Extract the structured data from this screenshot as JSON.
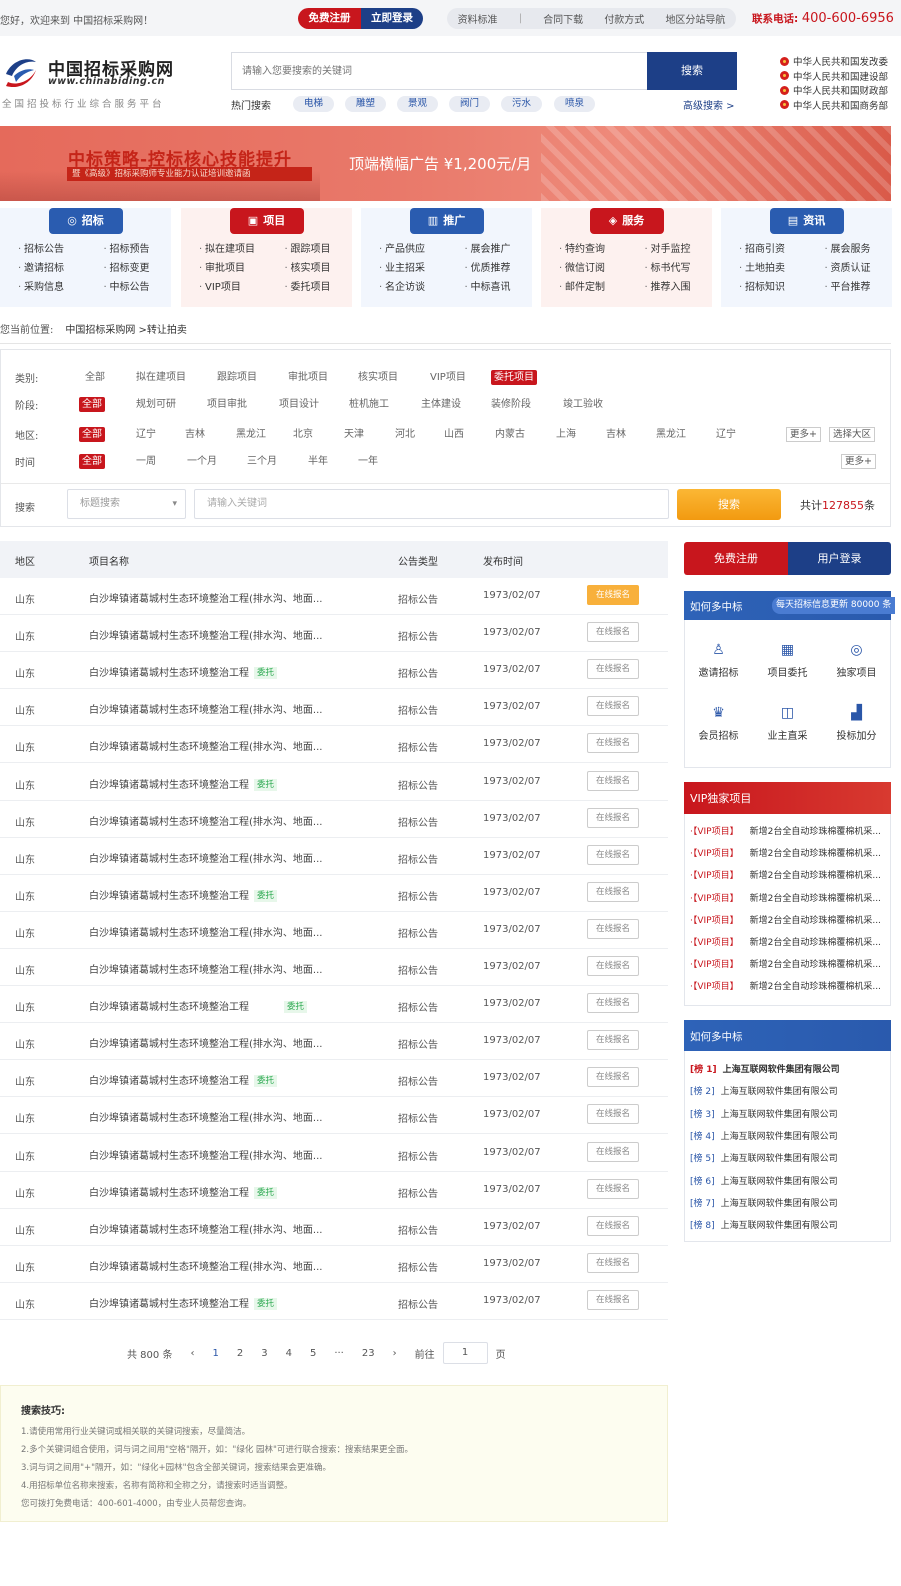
{
  "topbar": {
    "welcome": "您好，欢迎来到 中国招标采购网！",
    "free_register": "免费注册",
    "login": "立即登录",
    "links": [
      "资料标准",
      "合同下载",
      "付款方式",
      "地区分站导航"
    ],
    "hotline_label": "联系电话:",
    "hotline": "400-600-6956"
  },
  "header": {
    "logo_cn": "中国招标采购网",
    "logo_en": "www.chinabiding.cn",
    "slogan": "全国招投标行业综合服务平台",
    "search_placeholder": "请输入您要搜索的关键词",
    "search_button": "搜索",
    "hot_label": "热门搜索",
    "hot_tags": [
      "电梯",
      "雕塑",
      "景观",
      "阀门",
      "污水",
      "喷泉"
    ],
    "advanced_search": "高级搜索 >",
    "gov_links": [
      "中华人民共和国发改委",
      "中华人民共和国建设部",
      "中华人民共和国财政部",
      "中华人民共和国商务部"
    ]
  },
  "banner": {
    "title": "中标策略-控标核心技能提升",
    "subtitle": "暨《高级》招标采购师专业能力认证培训邀请函",
    "ad": "顶端横幅广告  ¥1,200元/月"
  },
  "nav_cards": [
    {
      "label": "招标",
      "color": "#2a5cb0",
      "icon": "gavel-icon",
      "glyph": "◎",
      "items": [
        "招标公告",
        "招标预告",
        "邀请招标",
        "招标变更",
        "采购信息",
        "中标公告"
      ],
      "bg": "#f2f6fd"
    },
    {
      "label": "项目",
      "color": "#c8161d",
      "icon": "briefcase-icon",
      "glyph": "▣",
      "items": [
        "拟在建项目",
        "跟踪项目",
        "审批项目",
        "核实项目",
        "VIP项目",
        "委托项目"
      ],
      "bg": "#fdf1ef"
    },
    {
      "label": "推广",
      "color": "#2a5cb0",
      "icon": "chart-icon",
      "glyph": "▥",
      "items": [
        "产品供应",
        "展会推广",
        "业主招采",
        "优质推荐",
        "名企访谈",
        "中标喜讯"
      ],
      "bg": "#f2f6fd"
    },
    {
      "label": "服务",
      "color": "#c8161d",
      "icon": "service-icon",
      "glyph": "◈",
      "items": [
        "特约查询",
        "对手监控",
        "微信订阅",
        "标书代写",
        "邮件定制",
        "推荐入围"
      ],
      "bg": "#fdf1ef"
    },
    {
      "label": "资讯",
      "color": "#2a5cb0",
      "icon": "news-icon",
      "glyph": "▤",
      "items": [
        "招商引资",
        "展会服务",
        "土地拍卖",
        "资质认证",
        "招标知识",
        "平台推荐"
      ],
      "bg": "#f2f6fd"
    }
  ],
  "breadcrumb": {
    "label": "您当前位置:",
    "path": "中国招标采购网 >转让拍卖"
  },
  "filters": {
    "category": {
      "label": "类别:",
      "options": [
        "全部",
        "拟在建项目",
        "跟踪项目",
        "审批项目",
        "核实项目",
        "VIP项目",
        "委托项目"
      ],
      "selected": 6
    },
    "stage": {
      "label": "阶段:",
      "options": [
        "全部",
        "规划可研",
        "项目审批",
        "项目设计",
        "桩机施工",
        "主体建设",
        "装修阶段",
        "竣工验收"
      ],
      "selected": 0
    },
    "region": {
      "label": "地区:",
      "options": [
        "全部",
        "辽宁",
        "吉林",
        "黑龙江",
        "北京",
        "天津",
        "河北",
        "山西",
        "内蒙古",
        "上海",
        "吉林",
        "黑龙江",
        "辽宁"
      ],
      "selected": 0,
      "more": "更多+",
      "pick_area": "选择大区"
    },
    "time": {
      "label": "时间",
      "options": [
        "全部",
        "一周",
        "一个月",
        "三个月",
        "半年",
        "一年"
      ],
      "selected": 0,
      "more": "更多+"
    }
  },
  "search2": {
    "label": "搜索",
    "select_value": "标题搜索",
    "placeholder": "请输入关键词",
    "button": "搜索",
    "total_prefix": "共计",
    "total_count": "127855",
    "total_suffix": "条"
  },
  "table": {
    "headers": [
      "地区",
      "项目名称",
      "公告类型",
      "发布时间"
    ],
    "register_label": "在线报名",
    "rows": [
      {
        "region": "山东",
        "name": "白沙埠镇诸葛城村生态环境整治工程(排水沟、地面...",
        "tag": "",
        "type": "招标公告",
        "date": "1973/02/07",
        "hot": true
      },
      {
        "region": "山东",
        "name": "白沙埠镇诸葛城村生态环境整治工程(排水沟、地面...",
        "tag": "",
        "type": "招标公告",
        "date": "1973/02/07",
        "hot": false
      },
      {
        "region": "山东",
        "name": "白沙埠镇诸葛城村生态环境整治工程",
        "tag": "委托",
        "type": "招标公告",
        "date": "1973/02/07",
        "hot": false
      },
      {
        "region": "山东",
        "name": "白沙埠镇诸葛城村生态环境整治工程(排水沟、地面...",
        "tag": "",
        "type": "招标公告",
        "date": "1973/02/07",
        "hot": false
      },
      {
        "region": "山东",
        "name": "白沙埠镇诸葛城村生态环境整治工程(排水沟、地面...",
        "tag": "",
        "type": "招标公告",
        "date": "1973/02/07",
        "hot": false
      },
      {
        "region": "山东",
        "name": "白沙埠镇诸葛城村生态环境整治工程",
        "tag": "委托",
        "type": "招标公告",
        "date": "1973/02/07",
        "hot": false
      },
      {
        "region": "山东",
        "name": "白沙埠镇诸葛城村生态环境整治工程(排水沟、地面...",
        "tag": "",
        "type": "招标公告",
        "date": "1973/02/07",
        "hot": false
      },
      {
        "region": "山东",
        "name": "白沙埠镇诸葛城村生态环境整治工程(排水沟、地面...",
        "tag": "",
        "type": "招标公告",
        "date": "1973/02/07",
        "hot": false
      },
      {
        "region": "山东",
        "name": "白沙埠镇诸葛城村生态环境整治工程",
        "tag": "委托",
        "type": "招标公告",
        "date": "1973/02/07",
        "hot": false
      },
      {
        "region": "山东",
        "name": "白沙埠镇诸葛城村生态环境整治工程(排水沟、地面...",
        "tag": "",
        "type": "招标公告",
        "date": "1973/02/07",
        "hot": false
      },
      {
        "region": "山东",
        "name": "白沙埠镇诸葛城村生态环境整治工程(排水沟、地面...",
        "tag": "",
        "type": "招标公告",
        "date": "1973/02/07",
        "hot": false
      },
      {
        "region": "山东",
        "name": "白沙埠镇诸葛城村生态环境整治工程",
        "tag": "委托",
        "type": "招标公告",
        "date": "1973/02/07",
        "hot": false,
        "wide_tag": true
      },
      {
        "region": "山东",
        "name": "白沙埠镇诸葛城村生态环境整治工程(排水沟、地面...",
        "tag": "",
        "type": "招标公告",
        "date": "1973/02/07",
        "hot": false
      },
      {
        "region": "山东",
        "name": "白沙埠镇诸葛城村生态环境整治工程",
        "tag": "委托",
        "type": "招标公告",
        "date": "1973/02/07",
        "hot": false
      },
      {
        "region": "山东",
        "name": "白沙埠镇诸葛城村生态环境整治工程(排水沟、地面...",
        "tag": "",
        "type": "招标公告",
        "date": "1973/02/07",
        "hot": false
      },
      {
        "region": "山东",
        "name": "白沙埠镇诸葛城村生态环境整治工程(排水沟、地面...",
        "tag": "",
        "type": "招标公告",
        "date": "1973/02/07",
        "hot": false
      },
      {
        "region": "山东",
        "name": "白沙埠镇诸葛城村生态环境整治工程",
        "tag": "委托",
        "type": "招标公告",
        "date": "1973/02/07",
        "hot": false
      },
      {
        "region": "山东",
        "name": "白沙埠镇诸葛城村生态环境整治工程(排水沟、地面...",
        "tag": "",
        "type": "招标公告",
        "date": "1973/02/07",
        "hot": false
      },
      {
        "region": "山东",
        "name": "白沙埠镇诸葛城村生态环境整治工程(排水沟、地面...",
        "tag": "",
        "type": "招标公告",
        "date": "1973/02/07",
        "hot": false
      },
      {
        "region": "山东",
        "name": "白沙埠镇诸葛城村生态环境整治工程",
        "tag": "委托",
        "type": "招标公告",
        "date": "1973/02/07",
        "hot": false
      }
    ]
  },
  "pager": {
    "total": "共 800 条",
    "prev": "‹",
    "pages": [
      "1",
      "2",
      "3",
      "4",
      "5",
      "···",
      "23"
    ],
    "current": "1",
    "next": "›",
    "goto_label": "前往",
    "goto_value": "1",
    "goto_suffix": "页"
  },
  "tips": {
    "title": "搜索技巧:",
    "lines": [
      "1.请使用常用行业关键词或相关联的关键词搜索，尽量简洁。",
      "2.多个关键词组合使用，词与词之间用\"空格\"隔开，如：\"绿化 园林\"可进行联合搜索：搜索结果更全面。",
      "3.词与词之间用\"+\"隔开，如：\"绿化+园林\"包含全部关键词，搜索结果会更准确。",
      "4.用招标单位名称来搜索，名称有简称和全称之分，请搜索时适当调整。",
      "您可拨打免费电话：400-601-4000，由专业人员帮您查询。"
    ]
  },
  "sidebar": {
    "register": "免费注册",
    "login": "用户登录",
    "box1_title": "如何多中标",
    "box1_badge": "每天招标信息更新 80000 条",
    "quick": [
      {
        "label": "邀请招标",
        "icon": "invite-user-icon",
        "glyph": "♙"
      },
      {
        "label": "项目委托",
        "icon": "document-icon",
        "glyph": "▦"
      },
      {
        "label": "独家项目",
        "icon": "target-icon",
        "glyph": "◎"
      },
      {
        "label": "会员招标",
        "icon": "crown-icon",
        "glyph": "♛"
      },
      {
        "label": "业主直采",
        "icon": "basket-icon",
        "glyph": "◫"
      },
      {
        "label": "投标加分",
        "icon": "bar-chart-icon",
        "glyph": "▟"
      }
    ],
    "vip_title": "VIP独家项目",
    "vip_prefix": "·【VIP项目】",
    "vip_items": [
      "新增2台全自动珍珠棉覆棉机采...",
      "新增2台全自动珍珠棉覆棉机采...",
      "新增2台全自动珍珠棉覆棉机采...",
      "新增2台全自动珍珠棉覆棉机采...",
      "新增2台全自动珍珠棉覆棉机采...",
      "新增2台全自动珍珠棉覆棉机采...",
      "新增2台全自动珍珠棉覆棉机采...",
      "新增2台全自动珍珠棉覆棉机采..."
    ],
    "rank_title": "如何多中标",
    "rank_items": [
      {
        "rank": "[榜 1]",
        "name": "上海互联网软件集团有限公司"
      },
      {
        "rank": "[榜 2]",
        "name": "上海互联网软件集团有限公司"
      },
      {
        "rank": "[榜 3]",
        "name": "上海互联网软件集团有限公司"
      },
      {
        "rank": "[榜 4]",
        "name": "上海互联网软件集团有限公司"
      },
      {
        "rank": "[榜 5]",
        "name": "上海互联网软件集团有限公司"
      },
      {
        "rank": "[榜 6]",
        "name": "上海互联网软件集团有限公司"
      },
      {
        "rank": "[榜 7]",
        "name": "上海互联网软件集团有限公司"
      },
      {
        "rank": "[榜 8]",
        "name": "上海互联网软件集团有限公司"
      }
    ]
  }
}
